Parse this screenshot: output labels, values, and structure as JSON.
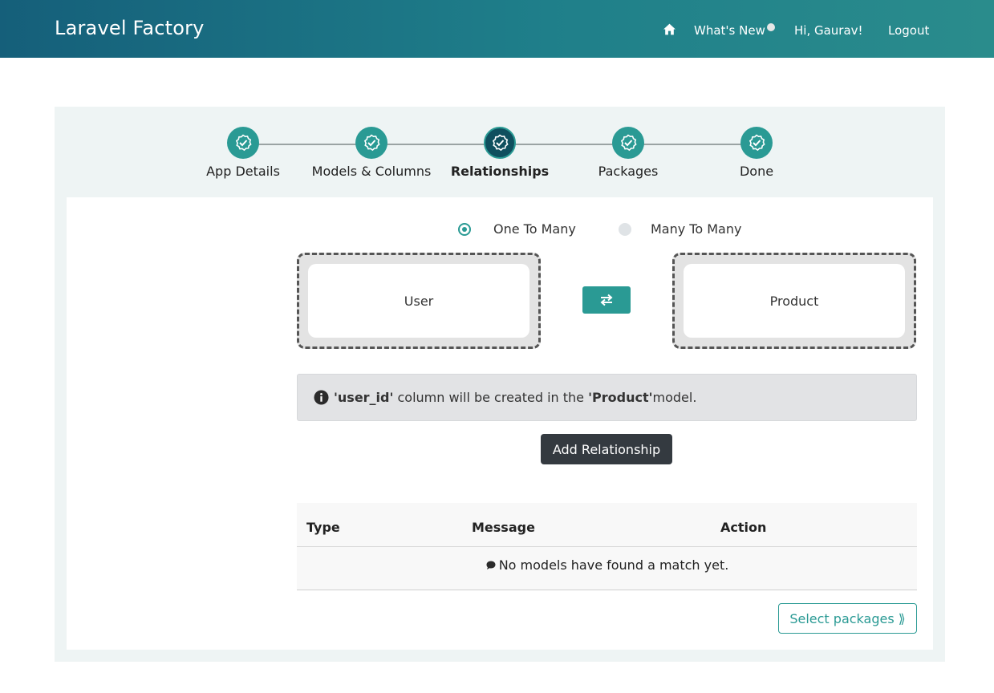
{
  "navbar": {
    "brand": "Laravel Factory",
    "home_icon": "home-icon",
    "whats_new": "What's New",
    "greeting": "Hi, Gaurav!",
    "logout": "Logout"
  },
  "stepper": {
    "steps": [
      {
        "label": "App Details",
        "icon": "check-circle-icon",
        "state": "done"
      },
      {
        "label": "Models & Columns",
        "icon": "check-circle-icon",
        "state": "done"
      },
      {
        "label": "Relationships",
        "icon": "check-circle-icon",
        "state": "active"
      },
      {
        "label": "Packages",
        "icon": "check-circle-icon",
        "state": "done"
      },
      {
        "label": "Done",
        "icon": "check-circle-icon",
        "state": "done"
      }
    ]
  },
  "relationship": {
    "options": [
      {
        "label": "One To Many",
        "selected": true
      },
      {
        "label": "Many To Many",
        "selected": false
      }
    ],
    "left_model": "User",
    "right_model": "Product",
    "swap_icon": "swap-arrows-icon"
  },
  "info": {
    "icon": "info-circle-icon",
    "column": "'user_id'",
    "text_mid": " column will be created in the ",
    "model": "'Product'",
    "text_end": " model."
  },
  "add_button": "Add Relationship",
  "table": {
    "headers": [
      "Type",
      "Message",
      "Action"
    ],
    "empty_icon": "comment-icon",
    "empty_message": "No models have found a match yet."
  },
  "next_button": "Select packages ⟫",
  "colors": {
    "primary": "#2a9a94",
    "navbar_start": "#155f7a",
    "navbar_end": "#2a8c8c",
    "active_step": "#0f4f5e",
    "dark_button": "#343a40"
  }
}
